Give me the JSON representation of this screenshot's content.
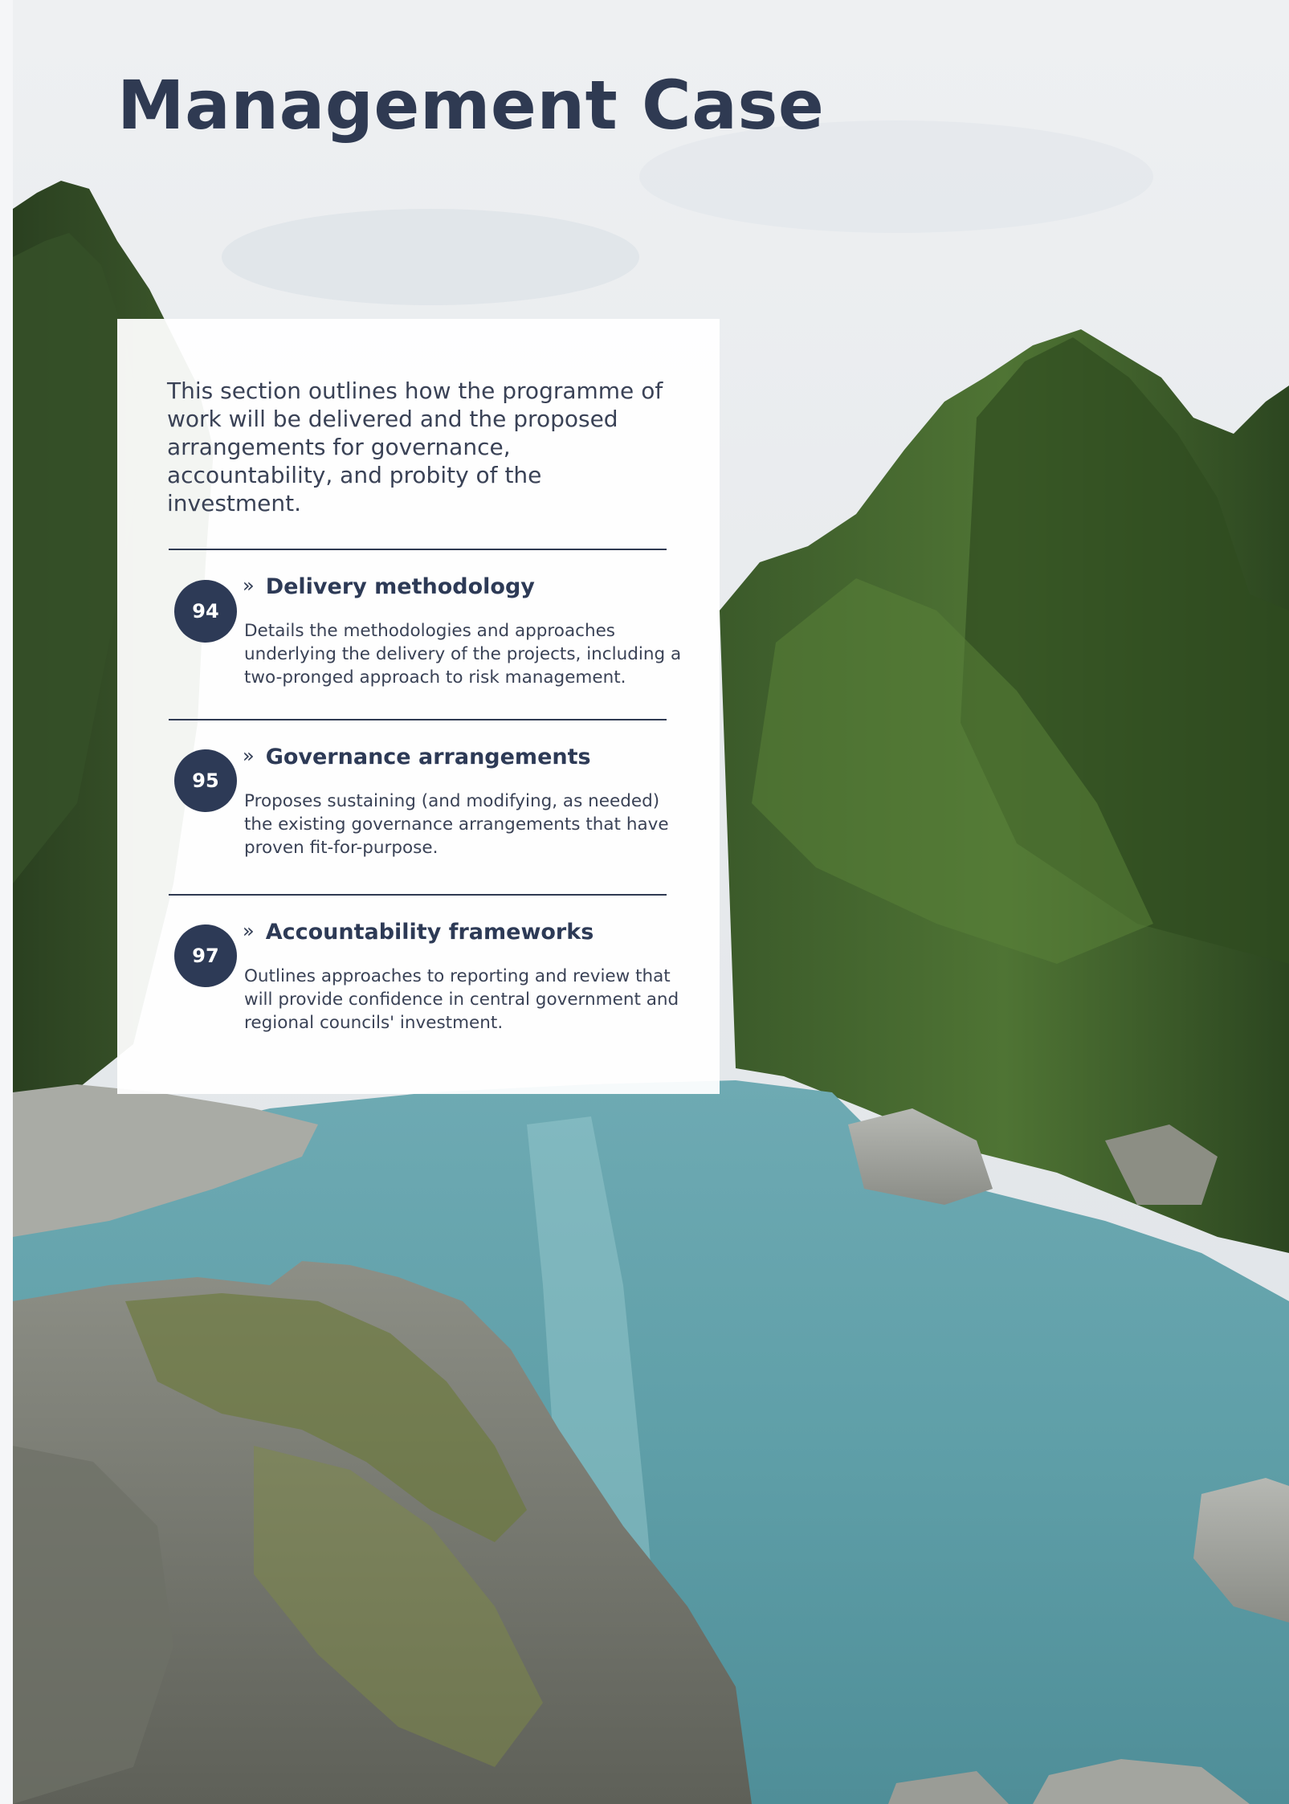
{
  "page": {
    "title": "Management Case"
  },
  "photo": {
    "icon": "river-gorge-photo"
  },
  "intro": {
    "text": "This section outlines how the programme of work will be delivered and the proposed arrangements for governance, accountability, and probity of the investment."
  },
  "sections": [
    {
      "page": "94",
      "chevron": "»",
      "title": "Delivery methodology",
      "description": "Details the methodologies and approaches underlying the delivery of the projects, including a two-pronged approach to risk management."
    },
    {
      "page": "95",
      "chevron": "»",
      "title": "Governance arrangements",
      "description": "Proposes sustaining (and modifying, as needed) the existing governance arrangements that have proven fit-for-purpose."
    },
    {
      "page": "97",
      "chevron": "»",
      "title": "Accountability frameworks",
      "description": "Outlines approaches to reporting and review that will provide confidence in central government and regional councils' investment."
    }
  ],
  "colors": {
    "navy": "#2d3a56",
    "text": "#3a4256",
    "water": "#5fa3ab",
    "forest": "#2f4a22",
    "sky": "#e9ecef"
  }
}
